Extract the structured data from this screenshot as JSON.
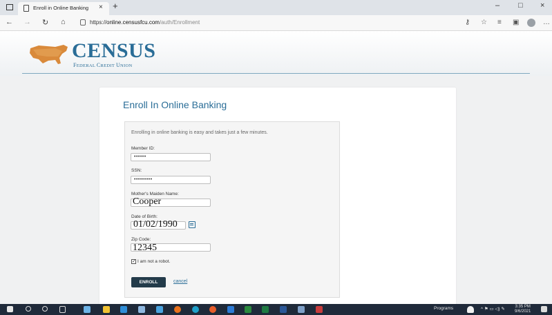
{
  "browser": {
    "tab_title": "Enroll in Online Banking",
    "tab_close": "×",
    "new_tab": "+",
    "url_scheme": "https://",
    "url_host": "online.censusfcu.com",
    "url_path": "/auth/Enrollment",
    "window_controls": [
      "–",
      "□",
      "×"
    ]
  },
  "header": {
    "logo_name": "CENSUS",
    "logo_sub_1": "F",
    "logo_sub_2": "EDERAL ",
    "logo_sub_3": "C",
    "logo_sub_4": "REDIT ",
    "logo_sub_5": "U",
    "logo_sub_6": "NION",
    "brand_color": "#2a6d97"
  },
  "form": {
    "title": "Enroll In Online Banking",
    "intro": "Enrolling in online banking is easy and takes just a few minutes.",
    "member_id_label": "Member ID:",
    "member_id_value": "••••••",
    "ssn_label": "SSN:",
    "ssn_value": "•••••••••",
    "maiden_label": "Mother's Maiden Name:",
    "maiden_value": "Cooper",
    "dob_label": "Date of Birth:",
    "dob_value": "01/02/1990",
    "zip_label": "Zip Code:",
    "zip_value": "12345",
    "robot_label": "I am not a robot.",
    "robot_checked": "✓",
    "enroll_button": "ENROLL",
    "cancel_link": "cancel"
  },
  "taskbar": {
    "programs_label": "Programs",
    "time": "3:35 PM",
    "date": "9/6/2021"
  }
}
